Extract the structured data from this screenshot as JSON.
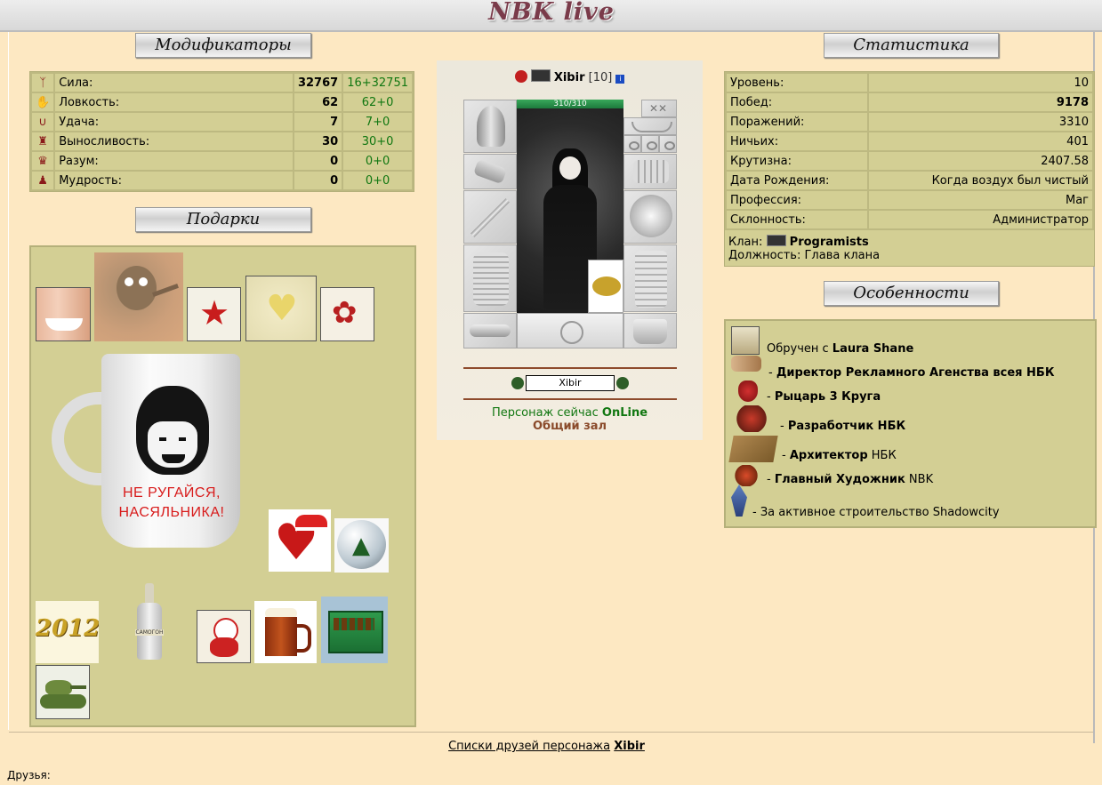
{
  "header": {
    "logo_text": "NBK live"
  },
  "modifiers": {
    "title": "Модификаторы",
    "rows": [
      {
        "icon": "strength-icon",
        "label": "Сила:",
        "value": "32767",
        "bonus": "16+32751"
      },
      {
        "icon": "agility-icon",
        "label": "Ловкость:",
        "value": "62",
        "bonus": "62+0"
      },
      {
        "icon": "luck-icon",
        "label": "Удача:",
        "value": "7",
        "bonus": "7+0"
      },
      {
        "icon": "endurance-icon",
        "label": "Выносливость:",
        "value": "30",
        "bonus": "30+0"
      },
      {
        "icon": "intellect-icon",
        "label": "Разум:",
        "value": "0",
        "bonus": "0+0"
      },
      {
        "icon": "wisdom-icon",
        "label": "Мудрость:",
        "value": "0",
        "bonus": "0+0"
      }
    ]
  },
  "gifts": {
    "title": "Подарки",
    "mug_text_line1": "НЕ РУГАЙСЯ,",
    "mug_text_line2": "НАСЯЛЬНИКА!",
    "calendar_text": "2012",
    "bottle_label": "САМОГОН"
  },
  "character": {
    "name": "Xibir",
    "level": "[10]",
    "hp": "310/310",
    "name_field": "Xibir",
    "status_prefix": "Персонаж сейчас",
    "status_value": "OnLine",
    "location": "Общий зал"
  },
  "statistics": {
    "title": "Статистика",
    "rows": [
      {
        "label": "Уровень:",
        "value": "10",
        "bold": false
      },
      {
        "label": "Побед:",
        "value": "9178",
        "bold": true
      },
      {
        "label": "Поражений:",
        "value": "3310",
        "bold": false
      },
      {
        "label": "Ничьих:",
        "value": "401",
        "bold": false
      },
      {
        "label": "Крутизна:",
        "value": "2407.58",
        "bold": false
      },
      {
        "label": "Дата Рождения:",
        "value": "Когда воздух был чистый",
        "bold": false
      },
      {
        "label": "Профессия:",
        "value": "Маг",
        "bold": false
      },
      {
        "label": "Склонность:",
        "value": "Администратор",
        "bold": false
      }
    ],
    "clan_label": "Клан:",
    "clan_name": "Programists",
    "position_label": "Должность:",
    "position_value": "Глава клана"
  },
  "features": {
    "title": "Особенности",
    "items": [
      {
        "pre": "Обручен с ",
        "bold": "Laura Shane",
        "post": ""
      },
      {
        "pre": "- ",
        "bold": "Директор Рекламного Агенства всея НБК",
        "post": ""
      },
      {
        "pre": "- ",
        "bold": "Рыцарь 3 Круга",
        "post": ""
      },
      {
        "pre": "- ",
        "bold": "Разработчик НБК",
        "post": ""
      },
      {
        "pre": "- ",
        "bold": "Архитектор",
        "post": " НБК"
      },
      {
        "pre": "- ",
        "bold": "Главный Художник",
        "post": " NBK"
      },
      {
        "pre": "- За активное строительство Shadowcity",
        "bold": "",
        "post": ""
      }
    ]
  },
  "footer": {
    "friends_link_prefix": "Списки друзей персонажа",
    "friends_link_name": "Xibir",
    "friends_label": "Друзья:"
  },
  "colors": {
    "panel": "#d3cf94",
    "background": "#fde8c2",
    "online": "#117711",
    "location": "#8a4a2a"
  }
}
